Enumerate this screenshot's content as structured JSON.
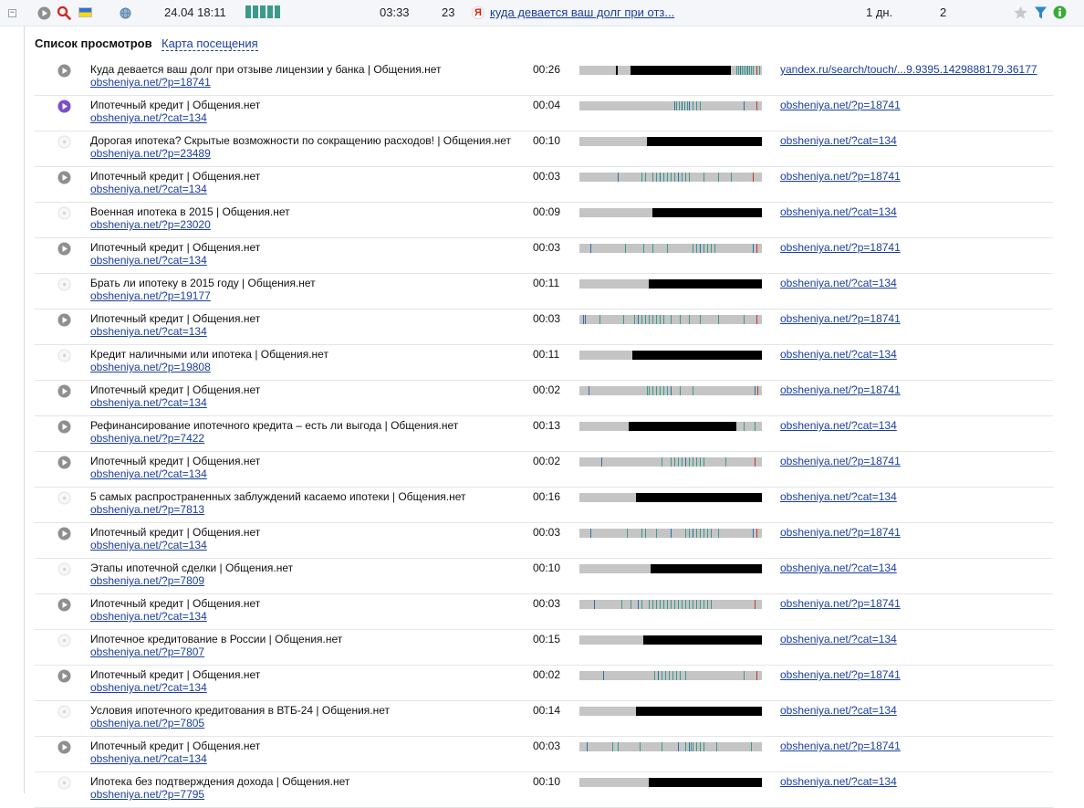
{
  "top": {
    "expand_symbol": "−",
    "datetime": "24.04 18:11",
    "duration": "03:33",
    "views": "23",
    "source_link": "куда девается ваш долг при отз...",
    "time_ago": "1 дн.",
    "visits": "2",
    "activity_bars": 5,
    "icons": [
      "play-icon",
      "search-icon",
      "ukraine-flag-icon",
      "globe-icon",
      "yandex-icon",
      "star-icon",
      "filter-icon",
      "info-icon"
    ],
    "colors": {
      "accent_teal": "#3c9a8a",
      "link": "#1a3f9a",
      "search_red": "#d0271d",
      "info_green": "#3aa83a",
      "filter_blue": "#2d86c9"
    }
  },
  "tabs": {
    "active": "Список просмотров",
    "map": "Карта посещения"
  },
  "rows": [
    {
      "title": "Куда девается ваш долг при отзыве лицензии у банка | Общения.нет",
      "url": "obsheniya.net/?p=18741",
      "duration": "00:26",
      "ref": "yandex.ru/search/touch/...9.9395.1429888179.36177",
      "ref_visited": false,
      "icon": "play",
      "black": [
        [
          0.2,
          0.21
        ],
        [
          0.28,
          0.83
        ]
      ],
      "ticks": [
        [
          0.86,
          "#3c9a8a"
        ],
        [
          0.87,
          "#3c9a8a"
        ],
        [
          0.88,
          "#2e6fa8"
        ],
        [
          0.89,
          "#3c9a8a"
        ],
        [
          0.9,
          "#3c9a8a"
        ],
        [
          0.91,
          "#3c9a8a"
        ],
        [
          0.92,
          "#2e6fa8"
        ],
        [
          0.93,
          "#3c9a8a"
        ],
        [
          0.94,
          "#3c9a8a"
        ],
        [
          0.95,
          "#3c9a8a"
        ],
        [
          0.97,
          "#c0392b"
        ],
        [
          0.985,
          "#3c9a8a"
        ]
      ]
    },
    {
      "title": "Ипотечный кредит | Общения.нет",
      "url": "obsheniya.net/?cat=134",
      "duration": "00:04",
      "ref": "obsheniya.net/?p=18741",
      "ref_visited": false,
      "icon": "play-active",
      "black": [],
      "ticks": [
        [
          0.52,
          "#2e6fa8"
        ],
        [
          0.53,
          "#3c9a8a"
        ],
        [
          0.545,
          "#3c9a8a"
        ],
        [
          0.56,
          "#2e6fa8"
        ],
        [
          0.575,
          "#3c9a8a"
        ],
        [
          0.59,
          "#3c9a8a"
        ],
        [
          0.6,
          "#2e6fa8"
        ],
        [
          0.62,
          "#3c9a8a"
        ],
        [
          0.64,
          "#3c9a8a"
        ],
        [
          0.66,
          "#3c9a8a"
        ],
        [
          0.9,
          "#2e6fa8"
        ],
        [
          0.97,
          "#c0392b"
        ]
      ]
    },
    {
      "title": "Дорогая ипотека? Скрытые возможности по сокращению расходов! | Общения.нет",
      "url": "obsheniya.net/?p=23489",
      "duration": "00:10",
      "ref": "obsheniya.net/?cat=134",
      "ref_visited": true,
      "icon": "dot",
      "black": [
        [
          0.37,
          1.0
        ]
      ],
      "ticks": []
    },
    {
      "title": "Ипотечный кредит | Общения.нет",
      "url": "obsheniya.net/?cat=134",
      "duration": "00:03",
      "ref": "obsheniya.net/?p=18741",
      "ref_visited": false,
      "icon": "play",
      "black": [],
      "ticks": [
        [
          0.21,
          "#2e6fa8"
        ],
        [
          0.34,
          "#3c9a8a"
        ],
        [
          0.36,
          "#3c9a8a"
        ],
        [
          0.4,
          "#3c9a8a"
        ],
        [
          0.42,
          "#3c9a8a"
        ],
        [
          0.44,
          "#2e6fa8"
        ],
        [
          0.46,
          "#3c9a8a"
        ],
        [
          0.48,
          "#3c9a8a"
        ],
        [
          0.5,
          "#3c9a8a"
        ],
        [
          0.52,
          "#3c9a8a"
        ],
        [
          0.54,
          "#2e6fa8"
        ],
        [
          0.56,
          "#3c9a8a"
        ],
        [
          0.58,
          "#3c9a8a"
        ],
        [
          0.6,
          "#3c9a8a"
        ],
        [
          0.68,
          "#3c9a8a"
        ],
        [
          0.76,
          "#3c9a8a"
        ],
        [
          0.83,
          "#3c9a8a"
        ],
        [
          0.95,
          "#c0392b"
        ]
      ]
    },
    {
      "title": "Военная ипотека в 2015 | Общения.нет",
      "url": "obsheniya.net/?p=23020",
      "duration": "00:09",
      "ref": "obsheniya.net/?cat=134",
      "ref_visited": true,
      "icon": "dot",
      "black": [
        [
          0.4,
          1.0
        ]
      ],
      "ticks": []
    },
    {
      "title": "Ипотечный кредит | Общения.нет",
      "url": "obsheniya.net/?cat=134",
      "duration": "00:03",
      "ref": "obsheniya.net/?p=18741",
      "ref_visited": false,
      "icon": "play",
      "black": [],
      "ticks": [
        [
          0.06,
          "#2e6fa8"
        ],
        [
          0.25,
          "#3c9a8a"
        ],
        [
          0.35,
          "#3c9a8a"
        ],
        [
          0.4,
          "#3c9a8a"
        ],
        [
          0.48,
          "#3c9a8a"
        ],
        [
          0.62,
          "#3c9a8a"
        ],
        [
          0.64,
          "#3c9a8a"
        ],
        [
          0.66,
          "#2e6fa8"
        ],
        [
          0.68,
          "#3c9a8a"
        ],
        [
          0.7,
          "#3c9a8a"
        ],
        [
          0.72,
          "#3c9a8a"
        ],
        [
          0.74,
          "#3c9a8a"
        ],
        [
          0.95,
          "#2e6fa8"
        ],
        [
          0.97,
          "#c0392b"
        ]
      ]
    },
    {
      "title": "Брать ли ипотеку в 2015 году | Общения.нет",
      "url": "obsheniya.net/?p=19177",
      "duration": "00:11",
      "ref": "obsheniya.net/?cat=134",
      "ref_visited": true,
      "icon": "dot",
      "black": [
        [
          0.38,
          1.0
        ]
      ],
      "ticks": []
    },
    {
      "title": "Ипотечный кредит | Общения.нет",
      "url": "obsheniya.net/?cat=134",
      "duration": "00:03",
      "ref": "obsheniya.net/?p=18741",
      "ref_visited": false,
      "icon": "play",
      "black": [],
      "ticks": [
        [
          0.02,
          "#2e6fa8"
        ],
        [
          0.03,
          "#2e6fa8"
        ],
        [
          0.11,
          "#3c9a8a"
        ],
        [
          0.24,
          "#3c9a8a"
        ],
        [
          0.3,
          "#3c9a8a"
        ],
        [
          0.32,
          "#2e6fa8"
        ],
        [
          0.34,
          "#3c9a8a"
        ],
        [
          0.36,
          "#3c9a8a"
        ],
        [
          0.38,
          "#3c9a8a"
        ],
        [
          0.4,
          "#3c9a8a"
        ],
        [
          0.42,
          "#3c9a8a"
        ],
        [
          0.44,
          "#3c9a8a"
        ],
        [
          0.46,
          "#3c9a8a"
        ],
        [
          0.5,
          "#3c9a8a"
        ],
        [
          0.55,
          "#3c9a8a"
        ],
        [
          0.6,
          "#3c9a8a"
        ],
        [
          0.66,
          "#3c9a8a"
        ],
        [
          0.76,
          "#3c9a8a"
        ],
        [
          0.9,
          "#3c9a8a"
        ],
        [
          0.97,
          "#c0392b"
        ]
      ]
    },
    {
      "title": "Кредит наличными или ипотека | Общения.нет",
      "url": "obsheniya.net/?p=19808",
      "duration": "00:11",
      "ref": "obsheniya.net/?cat=134",
      "ref_visited": true,
      "icon": "dot",
      "black": [
        [
          0.29,
          1.0
        ]
      ],
      "ticks": []
    },
    {
      "title": "Ипотечный кредит | Общения.нет",
      "url": "obsheniya.net/?cat=134",
      "duration": "00:02",
      "ref": "obsheniya.net/?p=18741",
      "ref_visited": false,
      "icon": "play",
      "black": [],
      "ticks": [
        [
          0.05,
          "#2e6fa8"
        ],
        [
          0.37,
          "#3c9a8a"
        ],
        [
          0.38,
          "#3c9a8a"
        ],
        [
          0.4,
          "#3c9a8a"
        ],
        [
          0.42,
          "#3c9a8a"
        ],
        [
          0.44,
          "#3c9a8a"
        ],
        [
          0.46,
          "#3c9a8a"
        ],
        [
          0.48,
          "#3c9a8a"
        ],
        [
          0.5,
          "#2e6fa8"
        ],
        [
          0.55,
          "#3c9a8a"
        ],
        [
          0.62,
          "#3c9a8a"
        ],
        [
          0.96,
          "#2e6fa8"
        ],
        [
          0.975,
          "#c0392b"
        ]
      ]
    },
    {
      "title": "Рефинансирование ипотечного кредита – есть ли выгода | Общения.нет",
      "url": "obsheniya.net/?p=7422",
      "duration": "00:13",
      "ref": "obsheniya.net/?cat=134",
      "ref_visited": true,
      "icon": "play",
      "black": [
        [
          0.27,
          0.86
        ]
      ],
      "ticks": [
        [
          0.9,
          "#3c9a8a"
        ],
        [
          0.96,
          "#3c9a8a"
        ]
      ]
    },
    {
      "title": "Ипотечный кредит | Общения.нет",
      "url": "obsheniya.net/?cat=134",
      "duration": "00:02",
      "ref": "obsheniya.net/?p=18741",
      "ref_visited": false,
      "icon": "play",
      "black": [],
      "ticks": [
        [
          0.12,
          "#2e6fa8"
        ],
        [
          0.45,
          "#3c9a8a"
        ],
        [
          0.5,
          "#3c9a8a"
        ],
        [
          0.52,
          "#3c9a8a"
        ],
        [
          0.54,
          "#3c9a8a"
        ],
        [
          0.56,
          "#3c9a8a"
        ],
        [
          0.58,
          "#2e6fa8"
        ],
        [
          0.6,
          "#3c9a8a"
        ],
        [
          0.62,
          "#3c9a8a"
        ],
        [
          0.64,
          "#3c9a8a"
        ],
        [
          0.66,
          "#3c9a8a"
        ],
        [
          0.68,
          "#3c9a8a"
        ],
        [
          0.8,
          "#3c9a8a"
        ],
        [
          0.96,
          "#c0392b"
        ]
      ]
    },
    {
      "title": "5 самых распространенных заблуждений касаемо ипотеки | Общения.нет",
      "url": "obsheniya.net/?p=7813",
      "duration": "00:16",
      "ref": "obsheniya.net/?cat=134",
      "ref_visited": true,
      "icon": "dot",
      "black": [
        [
          0.31,
          1.0
        ]
      ],
      "ticks": []
    },
    {
      "title": "Ипотечный кредит | Общения.нет",
      "url": "obsheniya.net/?cat=134",
      "duration": "00:03",
      "ref": "obsheniya.net/?p=18741",
      "ref_visited": false,
      "icon": "play",
      "black": [],
      "ticks": [
        [
          0.06,
          "#2e6fa8"
        ],
        [
          0.26,
          "#3c9a8a"
        ],
        [
          0.34,
          "#3c9a8a"
        ],
        [
          0.36,
          "#3c9a8a"
        ],
        [
          0.42,
          "#3c9a8a"
        ],
        [
          0.5,
          "#2e6fa8"
        ],
        [
          0.58,
          "#3c9a8a"
        ],
        [
          0.6,
          "#3c9a8a"
        ],
        [
          0.62,
          "#2e6fa8"
        ],
        [
          0.64,
          "#3c9a8a"
        ],
        [
          0.66,
          "#3c9a8a"
        ],
        [
          0.68,
          "#3c9a8a"
        ],
        [
          0.7,
          "#3c9a8a"
        ],
        [
          0.72,
          "#3c9a8a"
        ],
        [
          0.76,
          "#3c9a8a"
        ],
        [
          0.95,
          "#2e6fa8"
        ],
        [
          0.97,
          "#c0392b"
        ]
      ]
    },
    {
      "title": "Этапы ипотечной сделки | Общения.нет",
      "url": "obsheniya.net/?p=7809",
      "duration": "00:10",
      "ref": "obsheniya.net/?cat=134",
      "ref_visited": true,
      "icon": "dot",
      "black": [
        [
          0.39,
          1.0
        ]
      ],
      "ticks": []
    },
    {
      "title": "Ипотечный кредит | Общения.нет",
      "url": "obsheniya.net/?cat=134",
      "duration": "00:03",
      "ref": "obsheniya.net/?p=18741",
      "ref_visited": false,
      "icon": "play",
      "black": [],
      "ticks": [
        [
          0.08,
          "#2e6fa8"
        ],
        [
          0.23,
          "#3c9a8a"
        ],
        [
          0.28,
          "#3c9a8a"
        ],
        [
          0.32,
          "#2e6fa8"
        ],
        [
          0.34,
          "#3c9a8a"
        ],
        [
          0.38,
          "#3c9a8a"
        ],
        [
          0.4,
          "#3c9a8a"
        ],
        [
          0.42,
          "#3c9a8a"
        ],
        [
          0.44,
          "#3c9a8a"
        ],
        [
          0.46,
          "#3c9a8a"
        ],
        [
          0.48,
          "#3c9a8a"
        ],
        [
          0.5,
          "#3c9a8a"
        ],
        [
          0.52,
          "#3c9a8a"
        ],
        [
          0.54,
          "#3c9a8a"
        ],
        [
          0.56,
          "#3c9a8a"
        ],
        [
          0.58,
          "#3c9a8a"
        ],
        [
          0.6,
          "#3c9a8a"
        ],
        [
          0.62,
          "#3c9a8a"
        ],
        [
          0.64,
          "#3c9a8a"
        ],
        [
          0.66,
          "#3c9a8a"
        ],
        [
          0.68,
          "#3c9a8a"
        ],
        [
          0.7,
          "#3c9a8a"
        ],
        [
          0.72,
          "#3c9a8a"
        ],
        [
          0.96,
          "#c0392b"
        ]
      ]
    },
    {
      "title": "Ипотечное кредитование в России | Общения.нет",
      "url": "obsheniya.net/?p=7807",
      "duration": "00:15",
      "ref": "obsheniya.net/?cat=134",
      "ref_visited": true,
      "icon": "dot",
      "black": [
        [
          0.35,
          1.0
        ]
      ],
      "ticks": []
    },
    {
      "title": "Ипотечный кредит | Общения.нет",
      "url": "obsheniya.net/?cat=134",
      "duration": "00:02",
      "ref": "obsheniya.net/?p=18741",
      "ref_visited": false,
      "icon": "play",
      "black": [],
      "ticks": [
        [
          0.13,
          "#2e6fa8"
        ],
        [
          0.41,
          "#3c9a8a"
        ],
        [
          0.43,
          "#2e6fa8"
        ],
        [
          0.45,
          "#3c9a8a"
        ],
        [
          0.47,
          "#3c9a8a"
        ],
        [
          0.49,
          "#3c9a8a"
        ],
        [
          0.51,
          "#3c9a8a"
        ],
        [
          0.53,
          "#3c9a8a"
        ],
        [
          0.55,
          "#3c9a8a"
        ],
        [
          0.58,
          "#3c9a8a"
        ],
        [
          0.9,
          "#3c9a8a"
        ],
        [
          0.97,
          "#c0392b"
        ]
      ]
    },
    {
      "title": "Условия ипотечного кредитования в ВТБ-24 | Общения.нет",
      "url": "obsheniya.net/?p=7805",
      "duration": "00:14",
      "ref": "obsheniya.net/?cat=134",
      "ref_visited": true,
      "icon": "dot",
      "black": [
        [
          0.31,
          1.0
        ]
      ],
      "ticks": []
    },
    {
      "title": "Ипотечный кредит | Общения.нет",
      "url": "obsheniya.net/?cat=134",
      "duration": "00:03",
      "ref": "obsheniya.net/?p=18741",
      "ref_visited": false,
      "icon": "play",
      "black": [],
      "ticks": [
        [
          0.04,
          "#2e6fa8"
        ],
        [
          0.18,
          "#3c9a8a"
        ],
        [
          0.21,
          "#3c9a8a"
        ],
        [
          0.33,
          "#3c9a8a"
        ],
        [
          0.45,
          "#3c9a8a"
        ],
        [
          0.54,
          "#2e6fa8"
        ],
        [
          0.58,
          "#3c9a8a"
        ],
        [
          0.6,
          "#2e6fa8"
        ],
        [
          0.61,
          "#3c9a8a"
        ],
        [
          0.62,
          "#3c9a8a"
        ],
        [
          0.64,
          "#3c9a8a"
        ],
        [
          0.66,
          "#3c9a8a"
        ],
        [
          0.68,
          "#3c9a8a"
        ],
        [
          0.75,
          "#3c9a8a"
        ],
        [
          0.94,
          "#3c9a8a"
        ]
      ]
    },
    {
      "title": "Ипотека без подтверждения дохода | Общения.нет",
      "url": "obsheniya.net/?p=7795",
      "duration": "00:10",
      "ref": "obsheniya.net/?cat=134",
      "ref_visited": true,
      "icon": "dot",
      "black": [
        [
          0.38,
          1.0
        ]
      ],
      "ticks": []
    }
  ]
}
